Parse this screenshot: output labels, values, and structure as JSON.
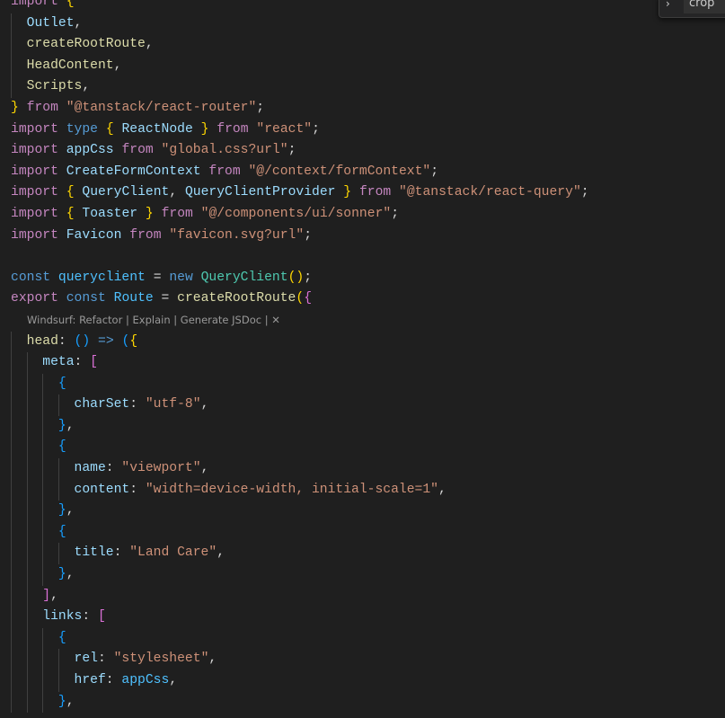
{
  "find_widget": {
    "toggle_icon": "chevron-right-icon",
    "query": "crop"
  },
  "codelens": "Windsurf: Refactor | Explain | Generate JSDoc | ✕",
  "lines": [
    [
      [
        "kw",
        "import"
      ],
      [
        "p",
        " "
      ],
      [
        "b1",
        "{"
      ]
    ],
    [
      [
        "p",
        "  "
      ],
      [
        "id",
        "Outlet"
      ],
      [
        "p",
        ","
      ]
    ],
    [
      [
        "p",
        "  "
      ],
      [
        "fn",
        "createRootRoute"
      ],
      [
        "p",
        ","
      ]
    ],
    [
      [
        "p",
        "  "
      ],
      [
        "fn",
        "HeadContent"
      ],
      [
        "p",
        ","
      ]
    ],
    [
      [
        "p",
        "  "
      ],
      [
        "fn",
        "Scripts"
      ],
      [
        "p",
        ","
      ]
    ],
    [
      [
        "b1",
        "}"
      ],
      [
        "p",
        " "
      ],
      [
        "kw",
        "from"
      ],
      [
        "p",
        " "
      ],
      [
        "str",
        "\"@tanstack/react-router\""
      ],
      [
        "p",
        ";"
      ]
    ],
    [
      [
        "kw",
        "import"
      ],
      [
        "p",
        " "
      ],
      [
        "st",
        "type"
      ],
      [
        "p",
        " "
      ],
      [
        "b1",
        "{"
      ],
      [
        "p",
        " "
      ],
      [
        "id",
        "ReactNode"
      ],
      [
        "p",
        " "
      ],
      [
        "b1",
        "}"
      ],
      [
        "p",
        " "
      ],
      [
        "kw",
        "from"
      ],
      [
        "p",
        " "
      ],
      [
        "str",
        "\"react\""
      ],
      [
        "p",
        ";"
      ]
    ],
    [
      [
        "kw",
        "import"
      ],
      [
        "p",
        " "
      ],
      [
        "id",
        "appCss"
      ],
      [
        "p",
        " "
      ],
      [
        "kw",
        "from"
      ],
      [
        "p",
        " "
      ],
      [
        "str",
        "\"global.css?url\""
      ],
      [
        "p",
        ";"
      ]
    ],
    [
      [
        "kw",
        "import"
      ],
      [
        "p",
        " "
      ],
      [
        "id",
        "CreateFormContext"
      ],
      [
        "p",
        " "
      ],
      [
        "kw",
        "from"
      ],
      [
        "p",
        " "
      ],
      [
        "str",
        "\"@/context/formContext\""
      ],
      [
        "p",
        ";"
      ]
    ],
    [
      [
        "kw",
        "import"
      ],
      [
        "p",
        " "
      ],
      [
        "b1",
        "{"
      ],
      [
        "p",
        " "
      ],
      [
        "id",
        "QueryClient"
      ],
      [
        "p",
        ", "
      ],
      [
        "id",
        "QueryClientProvider"
      ],
      [
        "p",
        " "
      ],
      [
        "b1",
        "}"
      ],
      [
        "p",
        " "
      ],
      [
        "kw",
        "from"
      ],
      [
        "p",
        " "
      ],
      [
        "str",
        "\"@tanstack/react-query\""
      ],
      [
        "p",
        ";"
      ]
    ],
    [
      [
        "kw",
        "import"
      ],
      [
        "p",
        " "
      ],
      [
        "b1",
        "{"
      ],
      [
        "p",
        " "
      ],
      [
        "id",
        "Toaster"
      ],
      [
        "p",
        " "
      ],
      [
        "b1",
        "}"
      ],
      [
        "p",
        " "
      ],
      [
        "kw",
        "from"
      ],
      [
        "p",
        " "
      ],
      [
        "str",
        "\"@/components/ui/sonner\""
      ],
      [
        "p",
        ";"
      ]
    ],
    [
      [
        "kw",
        "import"
      ],
      [
        "p",
        " "
      ],
      [
        "id",
        "Favicon"
      ],
      [
        "p",
        " "
      ],
      [
        "kw",
        "from"
      ],
      [
        "p",
        " "
      ],
      [
        "str",
        "\"favicon.svg?url\""
      ],
      [
        "p",
        ";"
      ]
    ],
    [],
    [
      [
        "st",
        "const"
      ],
      [
        "p",
        " "
      ],
      [
        "cn",
        "queryclient"
      ],
      [
        "p",
        " = "
      ],
      [
        "st",
        "new"
      ],
      [
        "p",
        " "
      ],
      [
        "cls",
        "QueryClient"
      ],
      [
        "b1",
        "()"
      ],
      [
        "p",
        ";"
      ]
    ],
    [
      [
        "kw",
        "export"
      ],
      [
        "p",
        " "
      ],
      [
        "st",
        "const"
      ],
      [
        "p",
        " "
      ],
      [
        "cn",
        "Route"
      ],
      [
        "p",
        " = "
      ],
      [
        "fn",
        "createRootRoute"
      ],
      [
        "b1",
        "("
      ],
      [
        "b2",
        "{"
      ]
    ],
    "CODELENS",
    [
      [
        "p",
        "  "
      ],
      [
        "fn",
        "head"
      ],
      [
        "p",
        ": "
      ],
      [
        "b3",
        "()"
      ],
      [
        "p",
        " "
      ],
      [
        "st",
        "=>"
      ],
      [
        "p",
        " "
      ],
      [
        "b3",
        "("
      ],
      [
        "b1",
        "{"
      ]
    ],
    [
      [
        "p",
        "    "
      ],
      [
        "id",
        "meta"
      ],
      [
        "p",
        ": "
      ],
      [
        "b2",
        "["
      ]
    ],
    [
      [
        "p",
        "      "
      ],
      [
        "b3",
        "{"
      ]
    ],
    [
      [
        "p",
        "        "
      ],
      [
        "id",
        "charSet"
      ],
      [
        "p",
        ": "
      ],
      [
        "str",
        "\"utf-8\""
      ],
      [
        "p",
        ","
      ]
    ],
    [
      [
        "p",
        "      "
      ],
      [
        "b3",
        "}"
      ],
      [
        "p",
        ","
      ]
    ],
    [
      [
        "p",
        "      "
      ],
      [
        "b3",
        "{"
      ]
    ],
    [
      [
        "p",
        "        "
      ],
      [
        "id",
        "name"
      ],
      [
        "p",
        ": "
      ],
      [
        "str",
        "\"viewport\""
      ],
      [
        "p",
        ","
      ]
    ],
    [
      [
        "p",
        "        "
      ],
      [
        "id",
        "content"
      ],
      [
        "p",
        ": "
      ],
      [
        "str",
        "\"width=device-width, initial-scale=1\""
      ],
      [
        "p",
        ","
      ]
    ],
    [
      [
        "p",
        "      "
      ],
      [
        "b3",
        "}"
      ],
      [
        "p",
        ","
      ]
    ],
    [
      [
        "p",
        "      "
      ],
      [
        "b3",
        "{"
      ]
    ],
    [
      [
        "p",
        "        "
      ],
      [
        "id",
        "title"
      ],
      [
        "p",
        ": "
      ],
      [
        "str",
        "\"Land Care\""
      ],
      [
        "p",
        ","
      ]
    ],
    [
      [
        "p",
        "      "
      ],
      [
        "b3",
        "}"
      ],
      [
        "p",
        ","
      ]
    ],
    [
      [
        "p",
        "    "
      ],
      [
        "b2",
        "]"
      ],
      [
        "p",
        ","
      ]
    ],
    [
      [
        "p",
        "    "
      ],
      [
        "id",
        "links"
      ],
      [
        "p",
        ": "
      ],
      [
        "b2",
        "["
      ]
    ],
    [
      [
        "p",
        "      "
      ],
      [
        "b3",
        "{"
      ]
    ],
    [
      [
        "p",
        "        "
      ],
      [
        "id",
        "rel"
      ],
      [
        "p",
        ": "
      ],
      [
        "str",
        "\"stylesheet\""
      ],
      [
        "p",
        ","
      ]
    ],
    [
      [
        "p",
        "        "
      ],
      [
        "id",
        "href"
      ],
      [
        "p",
        ": "
      ],
      [
        "cn",
        "appCss"
      ],
      [
        "p",
        ","
      ]
    ],
    [
      [
        "p",
        "      "
      ],
      [
        "b3",
        "}"
      ],
      [
        "p",
        ","
      ]
    ]
  ]
}
